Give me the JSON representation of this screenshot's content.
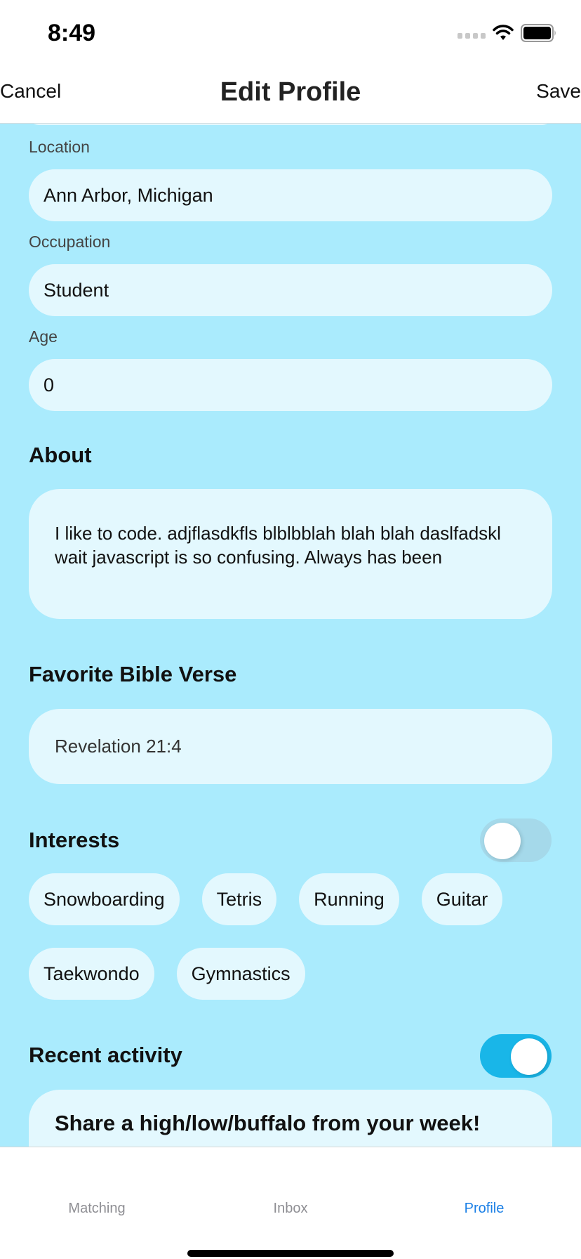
{
  "status_bar": {
    "time": "8:49",
    "icons": [
      "signal-icon",
      "wifi-icon",
      "battery-icon"
    ]
  },
  "nav": {
    "cancel_label": "Cancel",
    "title": "Edit Profile",
    "save_label": "Save"
  },
  "fields": {
    "location": {
      "label": "Location",
      "value": "Ann Arbor, Michigan"
    },
    "occupation": {
      "label": "Occupation",
      "value": "Student"
    },
    "age": {
      "label": "Age",
      "value": "0"
    }
  },
  "about": {
    "title": "About",
    "text": "I like to code. adjflasdkfls blblbblah blah blah daslfadskl wait javascript is so confusing. Always has been"
  },
  "bible_verse": {
    "title": "Favorite Bible Verse",
    "value": "Revelation 21:4"
  },
  "interests": {
    "title": "Interests",
    "toggle_on": false,
    "items": [
      "Snowboarding",
      "Tetris",
      "Running",
      "Guitar",
      "Taekwondo",
      "Gymnastics"
    ]
  },
  "recent_activity": {
    "title": "Recent activity",
    "toggle_on": true,
    "prompt": "Share a high/low/buffalo from your week!"
  },
  "tabbar": {
    "tabs": [
      {
        "label": "Matching",
        "active": false
      },
      {
        "label": "Inbox",
        "active": false
      },
      {
        "label": "Profile",
        "active": true
      }
    ]
  },
  "colors": {
    "background": "#aaebfd",
    "field": "#e3f8fe",
    "toggle_on": "#19b6e8",
    "toggle_off": "#a5d9ea",
    "active_tab": "#1a7fe6"
  }
}
